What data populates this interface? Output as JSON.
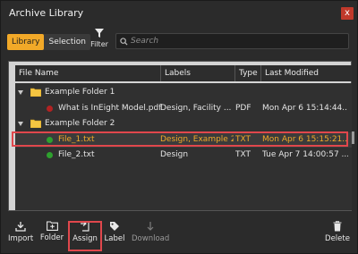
{
  "window": {
    "title": "Archive Library",
    "close_glyph": "x"
  },
  "toolbar": {
    "tabs": [
      {
        "label": "Library",
        "active": true
      },
      {
        "label": "Selection",
        "active": false
      }
    ],
    "filter_label": "Filter",
    "search_placeholder": "Search"
  },
  "table": {
    "columns": [
      "File Name",
      "Labels",
      "Type",
      "Last Modified"
    ],
    "rows": [
      {
        "kind": "folder",
        "name": "Example Folder 1",
        "labels": "",
        "type": "",
        "modified": ""
      },
      {
        "kind": "file",
        "status_color": "#b22222",
        "name": "What is InEight Model.pdf",
        "labels": "Design, Facility ...",
        "type": "PDF",
        "modified": "Mon Apr 6 15:14:44..."
      },
      {
        "kind": "folder",
        "name": "Example Folder 2",
        "labels": "",
        "type": "",
        "modified": ""
      },
      {
        "kind": "file",
        "status_color": "#2ea12e",
        "name": "File_1.txt",
        "labels": "Design, Example 2",
        "type": "TXT",
        "modified": "Mon Apr 6 15:15:21...",
        "selected": true
      },
      {
        "kind": "file",
        "status_color": "#2ea12e",
        "name": "File_2.txt",
        "labels": "Design",
        "type": "TXT",
        "modified": "Tue Apr 7 14:00:57 ..."
      }
    ]
  },
  "actions": {
    "import": "Import",
    "folder": "Folder",
    "assign": "Assign",
    "label": "Label",
    "download": "Download",
    "delete": "Delete"
  },
  "colors": {
    "accent": "#f2a928",
    "highlight": "#e0474c"
  }
}
